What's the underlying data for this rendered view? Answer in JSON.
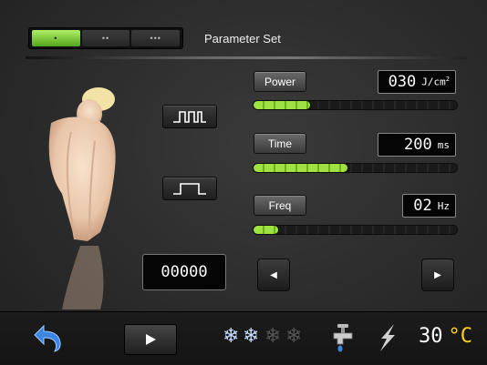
{
  "tabs": [
    {
      "label": "•",
      "active": true
    },
    {
      "label": "••",
      "active": false
    },
    {
      "label": "•••",
      "active": false
    }
  ],
  "title": "Parameter Set",
  "pulse_modes": [
    "multi-pulse",
    "single-pulse"
  ],
  "params": {
    "power": {
      "label": "Power",
      "value": "030",
      "unit": "J/cm",
      "unit_sup": "2",
      "level": 0.28
    },
    "time": {
      "label": "Time",
      "value": "200",
      "unit": "ms",
      "level": 0.46
    },
    "freq": {
      "label": "Freq",
      "value": "02",
      "unit": "Hz",
      "level": 0.12
    }
  },
  "counter": "00000",
  "arrows": {
    "left": "◀",
    "right": "▶"
  },
  "cooling": {
    "active_levels": 2,
    "total_levels": 4,
    "active_color": "#c8dcff",
    "inactive_color": "#555555"
  },
  "temperature": {
    "value": "30",
    "unit": "°C"
  },
  "colors": {
    "accent_green": "#9fe043",
    "temp_unit": "#ffd21a",
    "back_arrow": "#3b86e0"
  }
}
